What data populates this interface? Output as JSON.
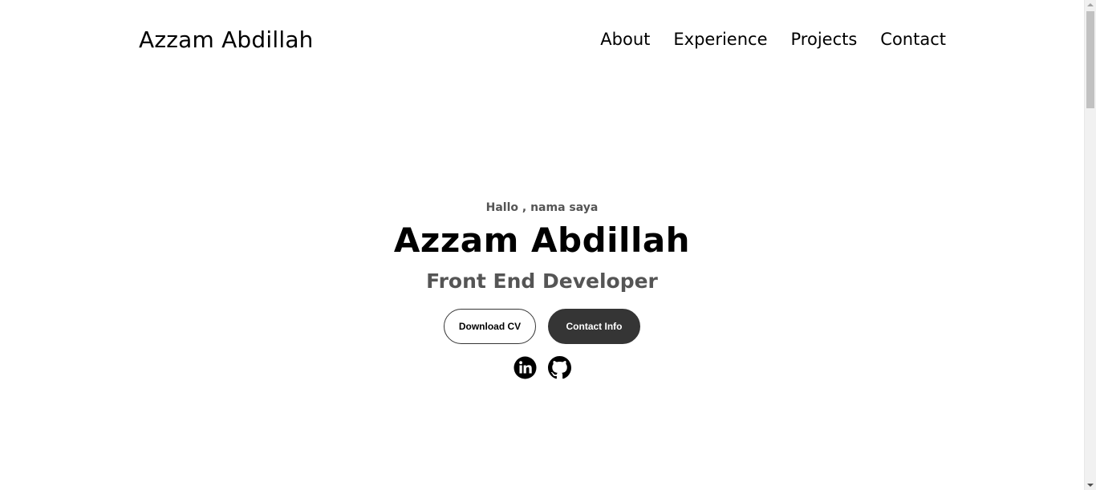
{
  "nav": {
    "logo": "Azzam Abdillah",
    "links": [
      "About",
      "Experience",
      "Projects",
      "Contact"
    ]
  },
  "hero": {
    "greeting": "Hallo , nama saya",
    "name": "Azzam Abdillah",
    "role": "Front End Developer",
    "buttons": {
      "download": "Download CV",
      "contact": "Contact Info"
    },
    "socials": [
      "linkedin-icon",
      "github-icon"
    ]
  },
  "colors": {
    "text": "#000000",
    "muted": "#555555",
    "button_dark": "#353535",
    "background": "#ffffff"
  }
}
